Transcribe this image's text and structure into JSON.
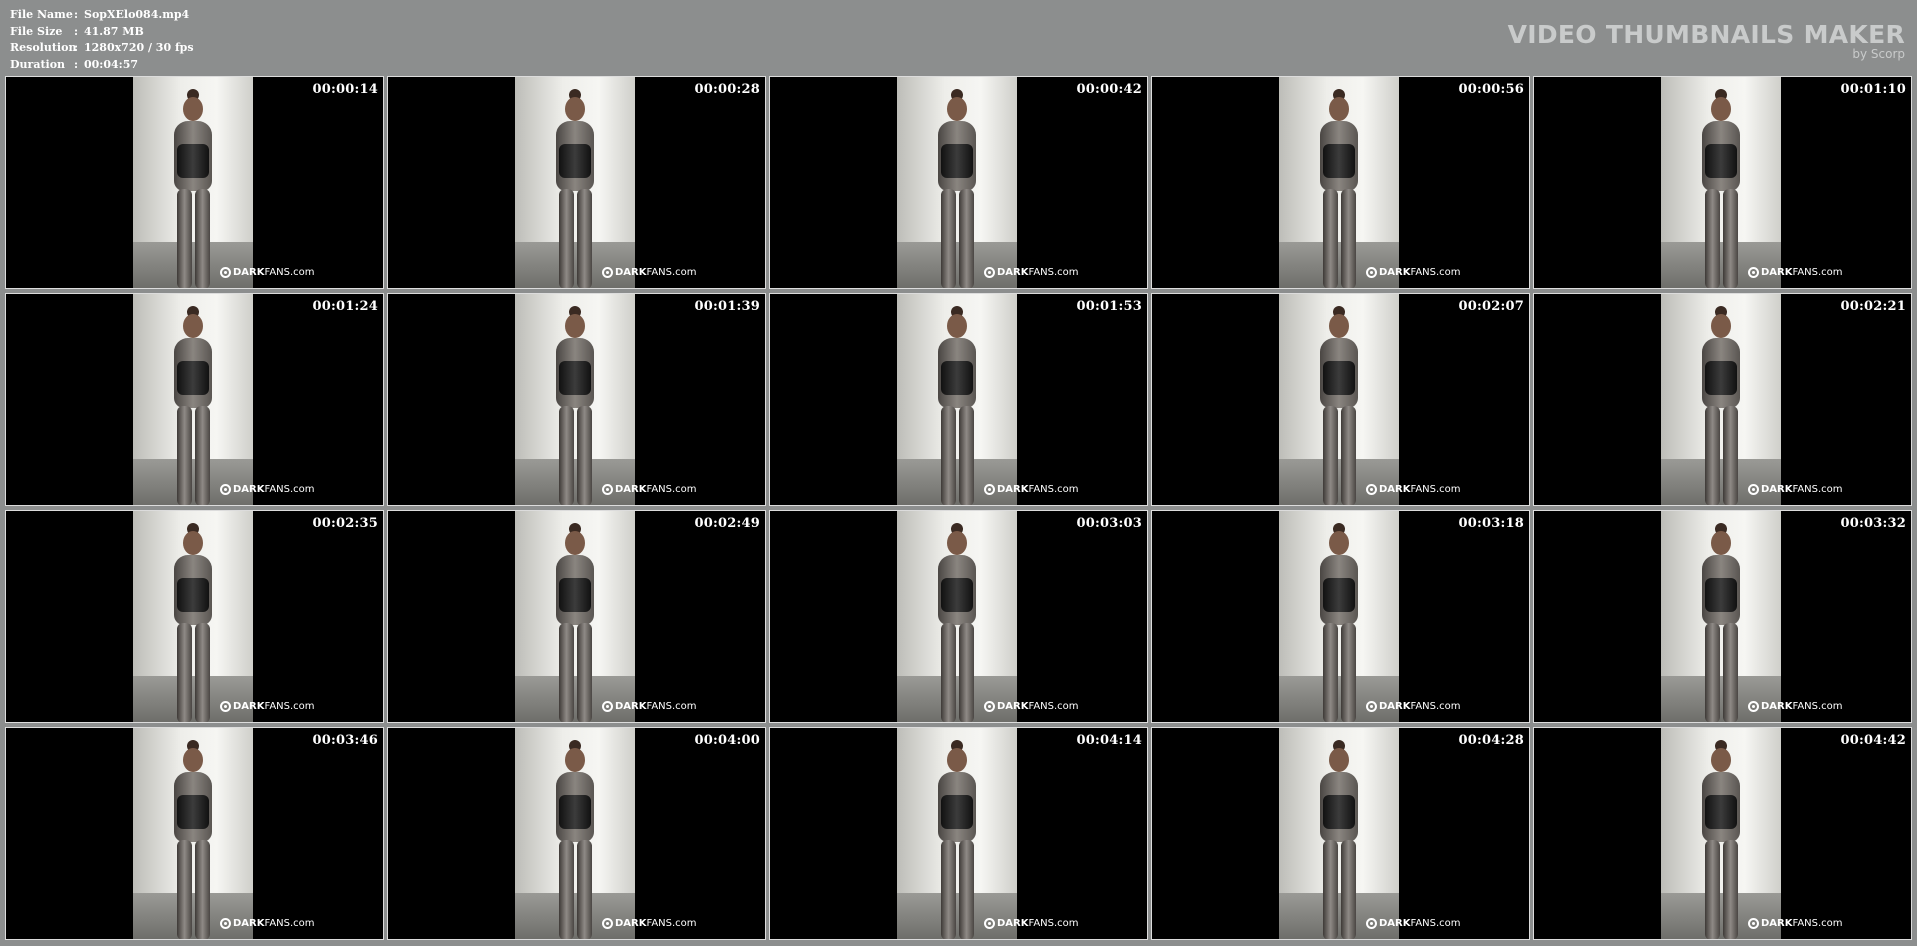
{
  "file_info": [
    {
      "label": "File Name",
      "value": "SopXElo084.mp4"
    },
    {
      "label": "File Size",
      "value": "41.87 MB"
    },
    {
      "label": "Resolution",
      "value": "1280x720 / 30 fps"
    },
    {
      "label": "Duration",
      "value": "00:04:57"
    }
  ],
  "brand": {
    "title": "VIDEO THUMBNAILS MAKER",
    "subtitle": "by Scorp"
  },
  "watermark": {
    "bold": "DARK",
    "light": "FANS.com"
  },
  "thumbnails": [
    {
      "time": "00:00:14"
    },
    {
      "time": "00:00:28"
    },
    {
      "time": "00:00:42"
    },
    {
      "time": "00:00:56"
    },
    {
      "time": "00:01:10"
    },
    {
      "time": "00:01:24"
    },
    {
      "time": "00:01:39"
    },
    {
      "time": "00:01:53"
    },
    {
      "time": "00:02:07"
    },
    {
      "time": "00:02:21"
    },
    {
      "time": "00:02:35"
    },
    {
      "time": "00:02:49"
    },
    {
      "time": "00:03:03"
    },
    {
      "time": "00:03:18"
    },
    {
      "time": "00:03:32"
    },
    {
      "time": "00:03:46"
    },
    {
      "time": "00:04:00"
    },
    {
      "time": "00:04:14"
    },
    {
      "time": "00:04:28"
    },
    {
      "time": "00:04:42"
    }
  ],
  "colors": {
    "background": "#8c8e8e",
    "thumb_border": "#dcdcdc",
    "timestamp": "#ffffff"
  }
}
